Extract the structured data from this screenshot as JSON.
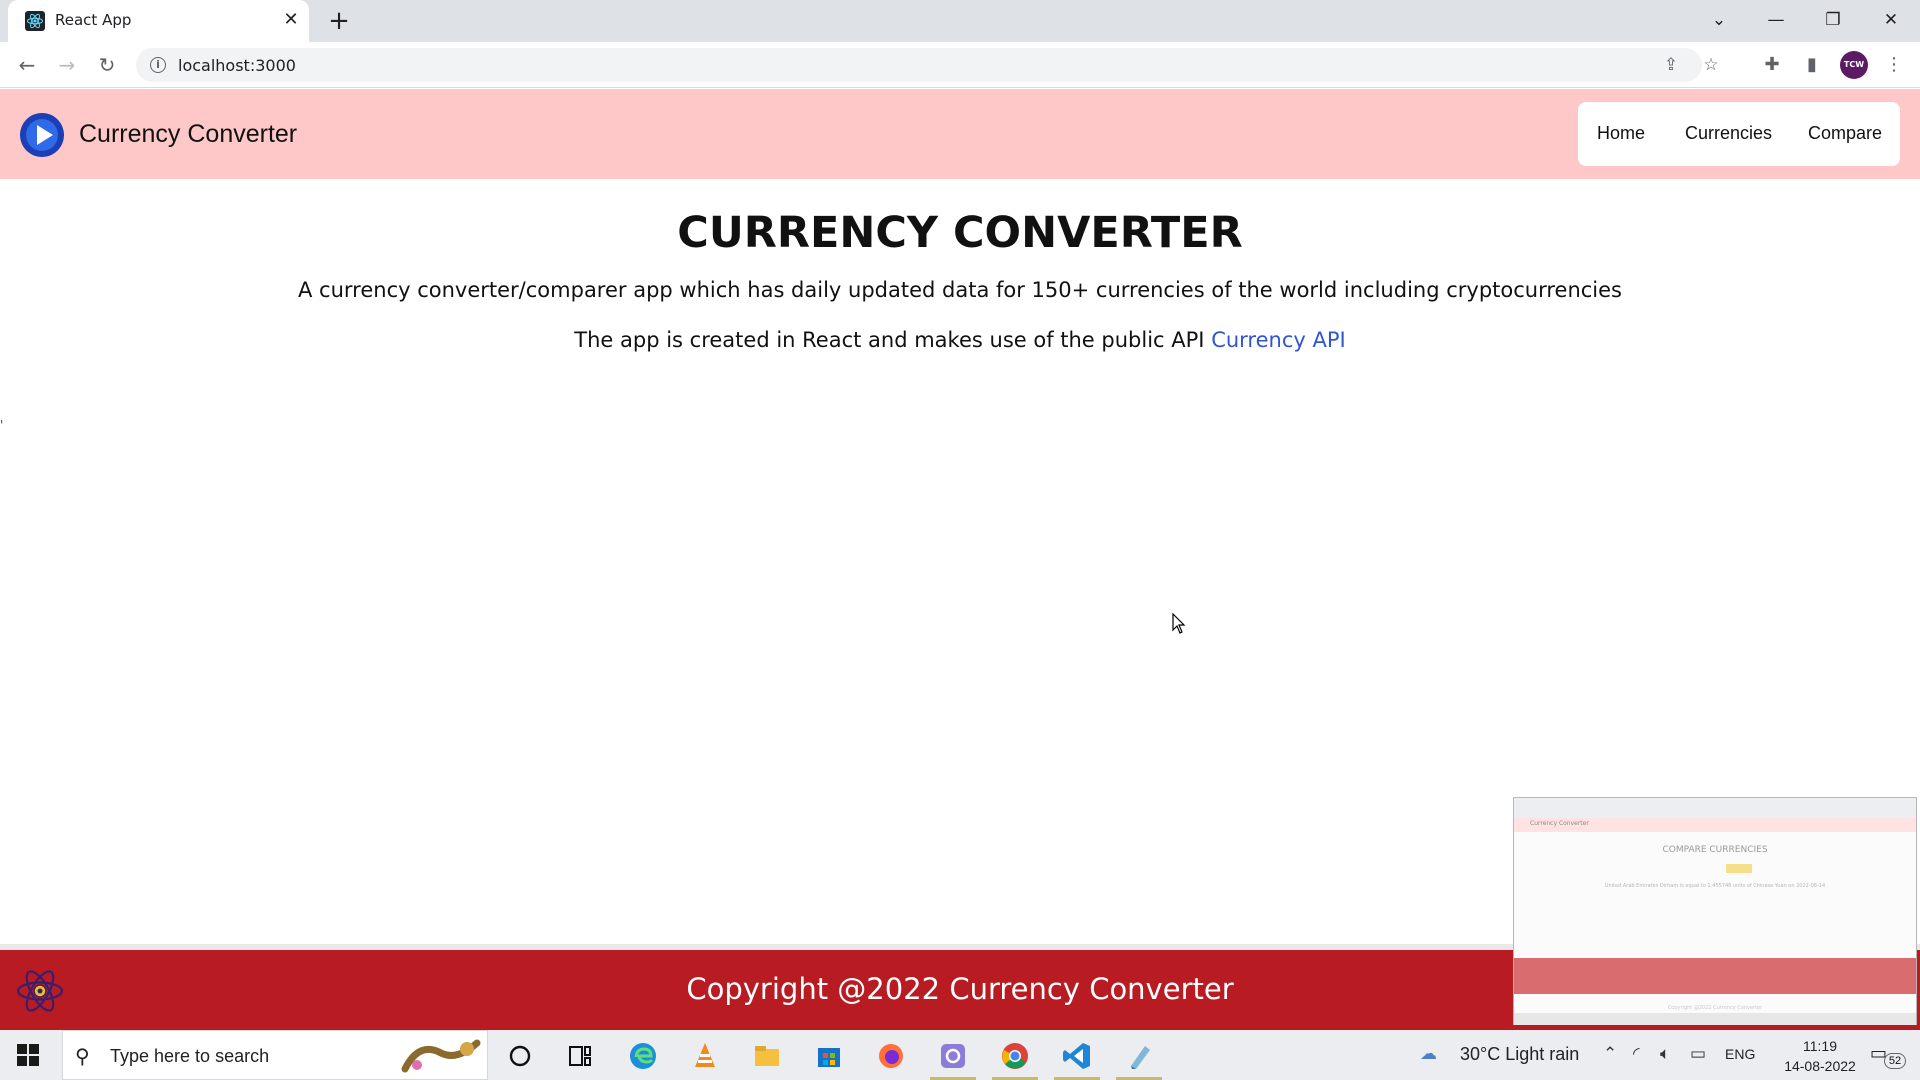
{
  "browser": {
    "tab_title": "React App",
    "new_tab_label": "+",
    "url": "localhost:3000"
  },
  "app": {
    "brand": "Currency Converter",
    "nav": {
      "home": "Home",
      "currencies": "Currencies",
      "compare": "Compare"
    },
    "heading": "CURRENCY CONVERTER",
    "description": "A currency converter/comparer app which has daily updated data for 150+ currencies of the world including cryptocurrencies",
    "api_text": "The app is created in React and makes use of the public API",
    "api_link": "Currency API",
    "stray_mark": "'",
    "footer": "Copyright @2022 Currency Converter"
  },
  "preview": {
    "brand": "Currency Converter",
    "heading": "COMPARE CURRENCIES",
    "text": "United Arab Emirates Dirham is equal to 1.455748 units of Chinese Yuan on 2022-08-14",
    "copyright": "Copyright @2022 Currency Converter"
  },
  "profile": {
    "initials": "TCW"
  },
  "taskbar": {
    "search_placeholder": "Type here to search",
    "weather": "30°C  Light rain",
    "language": "ENG",
    "time": "11:19",
    "date": "14-08-2022",
    "notification_count": "52"
  },
  "colors": {
    "navbar_bg": "#ffc8c8",
    "footer_bg": "#b81c22",
    "link": "#2f55d4"
  }
}
